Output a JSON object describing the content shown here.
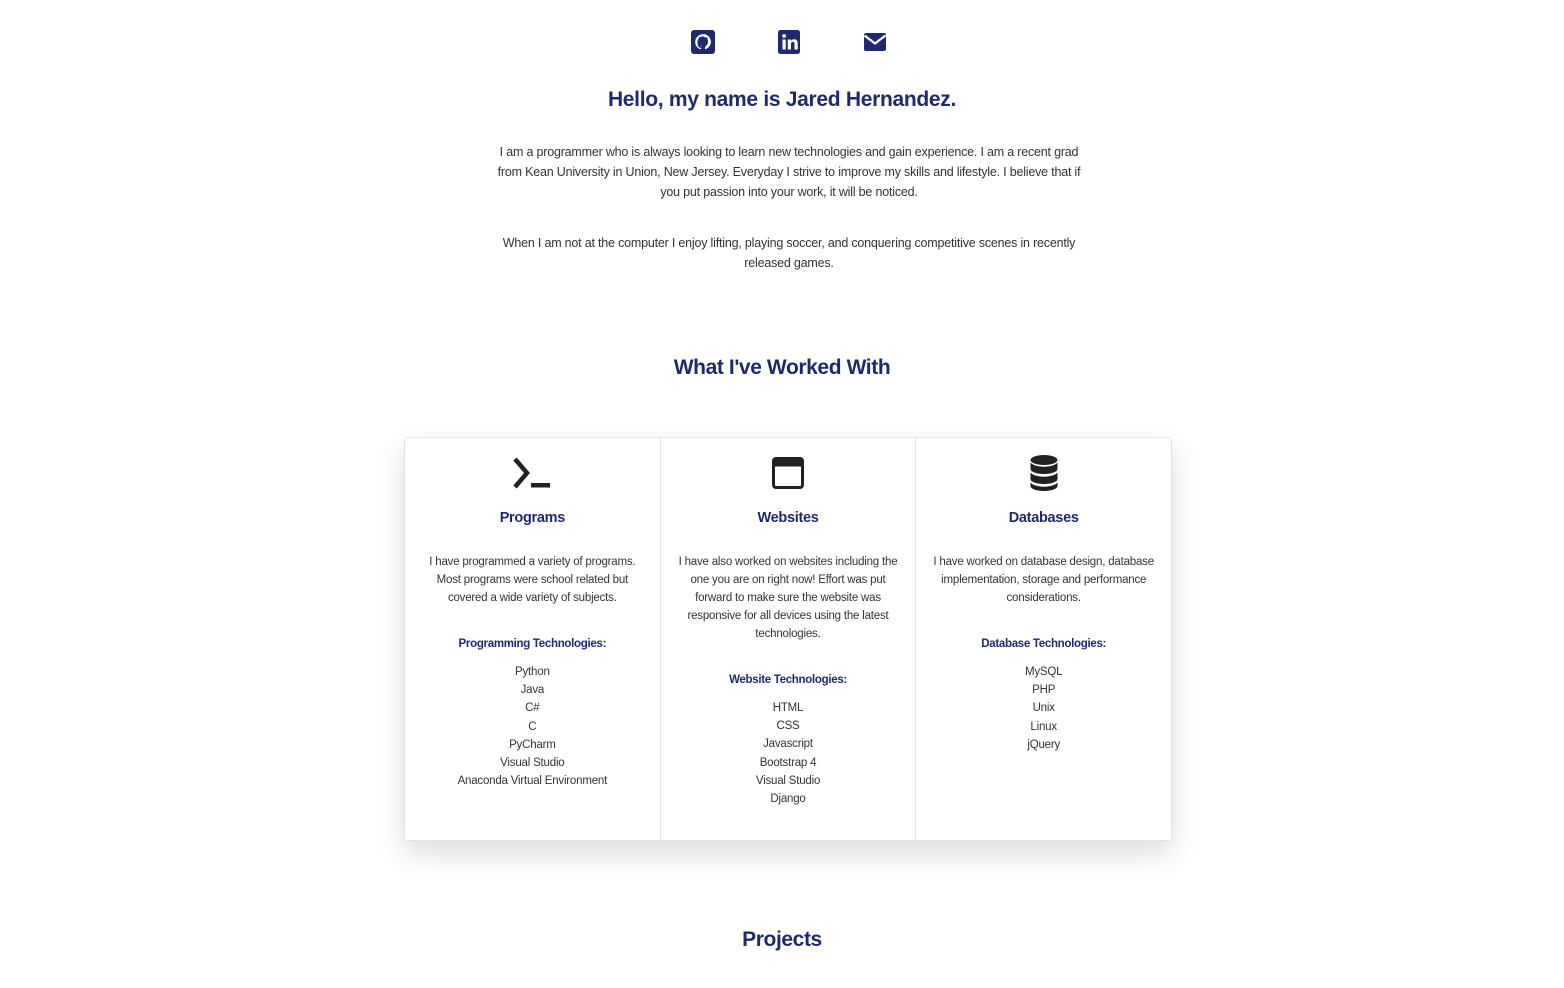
{
  "social": {
    "items": [
      {
        "icon": "github-icon",
        "label": "GitHub"
      },
      {
        "icon": "linkedin-icon",
        "label": "LinkedIn"
      },
      {
        "icon": "envelope-icon",
        "label": "Email"
      }
    ],
    "color": "#1f2a6e"
  },
  "intro": {
    "heading": "Hello, my name is Jared Hernandez.",
    "paragraph_1": "I am a programmer who is always looking to learn new technologies and gain experience. I am a recent grad from Kean University in Union, New Jersey. Everyday I strive to improve my skills and lifestyle. I believe that if you put passion into your work, it will be noticed.",
    "paragraph_2": "When I am not at the computer I enjoy lifting, playing soccer, and conquering competitive scenes in recently released games."
  },
  "worked_with": {
    "title": "What I've Worked With",
    "cards": [
      {
        "icon": "terminal-icon",
        "title": "Programs",
        "description": "I have programmed a variety of programs. Most programs were school related but covered a wide variety of subjects.",
        "subtitle": "Programming Technologies:",
        "items": [
          "Python",
          "Java",
          "C#",
          "C",
          "PyCharm",
          "Visual Studio",
          "Anaconda Virtual Environment"
        ]
      },
      {
        "icon": "browser-window-icon",
        "title": "Websites",
        "description": "I have also worked on websites including the one you are on right now! Effort was put forward to make sure the website was responsive for all devices using the latest technologies.",
        "subtitle": "Website Technologies:",
        "items": [
          "HTML",
          "CSS",
          "Javascript",
          "Bootstrap 4",
          "Visual Studio",
          "Django"
        ]
      },
      {
        "icon": "database-icon",
        "title": "Databases",
        "description": "I have worked on database design, database implementation, storage and performance considerations.",
        "subtitle": "Database Technologies:",
        "items": [
          "MySQL",
          "PHP",
          "Unix",
          "Linux",
          "jQuery"
        ]
      }
    ]
  },
  "projects": {
    "title": "Projects"
  },
  "colors": {
    "accent": "#1f2a6e",
    "text": "#333333",
    "icon_dark": "#212121"
  }
}
